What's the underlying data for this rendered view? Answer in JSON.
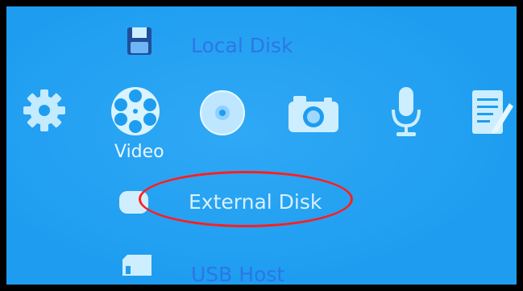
{
  "menu": {
    "top_item_label": "Local Disk",
    "selected_item_label": "External Disk",
    "bottom_item_label": "USB Host",
    "focused_category_label": "Video"
  },
  "icons": {
    "top_item": "floppy-disk-icon",
    "selected_item": "external-disk-icon",
    "bottom_item": "sd-card-icon",
    "categories": [
      "gear-icon",
      "film-reel-icon",
      "disc-icon",
      "camera-icon",
      "microphone-icon",
      "notepad-edit-icon"
    ]
  },
  "colors": {
    "screen_background": "#1e9df0",
    "icon_fill": "#cdeeff",
    "storage_label": "#2f6fe6",
    "annotation": "#ff1f1f"
  }
}
